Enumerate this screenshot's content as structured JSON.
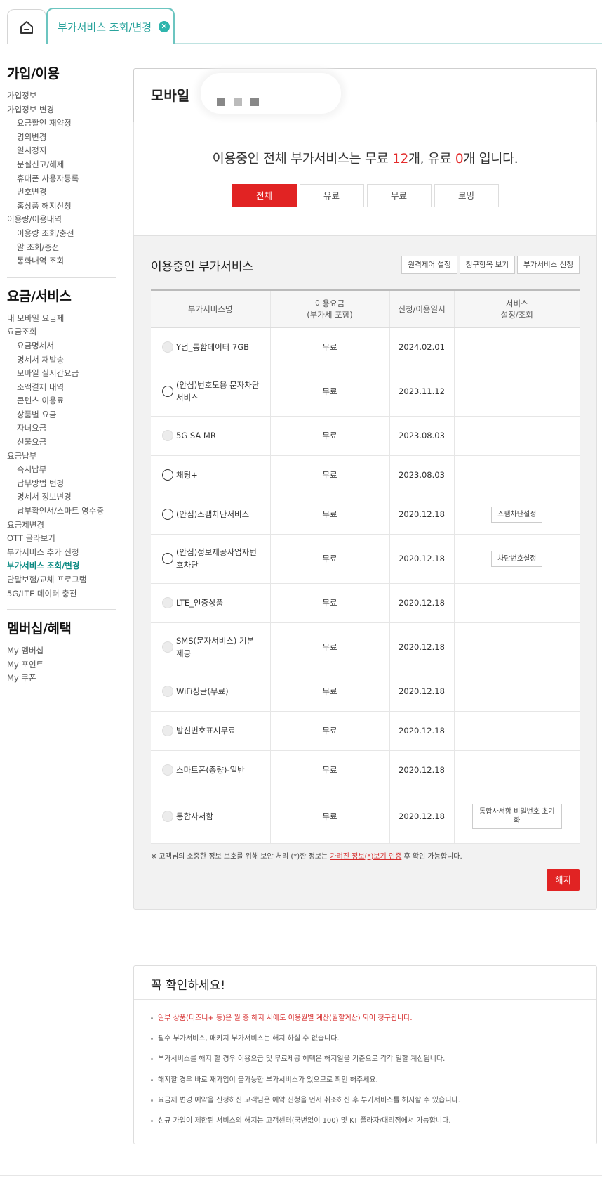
{
  "tabs": {
    "home_icon": "home-icon",
    "active_tab": "부가서비스 조회/변경",
    "close_glyph": "✕"
  },
  "sidebar": {
    "sections": [
      {
        "title": "가입/이용",
        "items": [
          {
            "label": "가입정보",
            "sub": false
          },
          {
            "label": "가입정보 변경",
            "sub": false
          },
          {
            "label": "요금할인 재약정",
            "sub": true
          },
          {
            "label": "명의변경",
            "sub": true
          },
          {
            "label": "일시정지",
            "sub": true
          },
          {
            "label": "분실신고/해제",
            "sub": true
          },
          {
            "label": "휴대폰 사용자등록",
            "sub": true
          },
          {
            "label": "번호변경",
            "sub": true
          },
          {
            "label": "홈상품 해지신청",
            "sub": true
          },
          {
            "label": "이용량/이용내역",
            "sub": false
          },
          {
            "label": "이용량 조회/충전",
            "sub": true
          },
          {
            "label": "알 조회/충전",
            "sub": true
          },
          {
            "label": "통화내역 조회",
            "sub": true
          }
        ]
      },
      {
        "title": "요금/서비스",
        "items": [
          {
            "label": "내 모바일 요금제",
            "sub": false
          },
          {
            "label": "요금조회",
            "sub": false
          },
          {
            "label": "요금명세서",
            "sub": true
          },
          {
            "label": "명세서 재발송",
            "sub": true
          },
          {
            "label": "모바일 실시간요금",
            "sub": true
          },
          {
            "label": "소액결제 내역",
            "sub": true
          },
          {
            "label": "콘텐츠 이용료",
            "sub": true
          },
          {
            "label": "상품별 요금",
            "sub": true
          },
          {
            "label": "자녀요금",
            "sub": true
          },
          {
            "label": "선불요금",
            "sub": true
          },
          {
            "label": "요금납부",
            "sub": false
          },
          {
            "label": "즉시납부",
            "sub": true
          },
          {
            "label": "납부방법 변경",
            "sub": true
          },
          {
            "label": "명세서 정보변경",
            "sub": true
          },
          {
            "label": "납부확인서/스마트 영수증",
            "sub": true
          },
          {
            "label": "요금제변경",
            "sub": false
          },
          {
            "label": "OTT 골라보기",
            "sub": false
          },
          {
            "label": "부가서비스 추가 신청",
            "sub": false
          },
          {
            "label": "부가서비스 조회/변경",
            "sub": false,
            "active": true
          },
          {
            "label": "단말보험/교체 프로그램",
            "sub": false
          },
          {
            "label": "5G/LTE 데이터 충전",
            "sub": false
          }
        ]
      },
      {
        "title": "멤버십/혜택",
        "items": [
          {
            "label": "My 멤버십",
            "sub": false
          },
          {
            "label": "My 포인트",
            "sub": false
          },
          {
            "label": "My 쿠폰",
            "sub": false
          }
        ]
      }
    ]
  },
  "main": {
    "mobile_title": "모바일",
    "summary": {
      "prefix": "이용중인 전체 부가서비스는 무료 ",
      "free_count": "12",
      "mid": "개, 유료 ",
      "paid_count": "0",
      "suffix": "개 입니다."
    },
    "filters": [
      "전체",
      "유료",
      "무료",
      "로밍"
    ],
    "active_filter": 0,
    "list_title": "이용중인 부가서비스",
    "list_buttons": [
      "원격제어 설정",
      "청구항목 보기",
      "부가서비스 신청"
    ],
    "table": {
      "headers": [
        "부가서비스명",
        "이용요금\n(부가세 포함)",
        "신청/이용일시",
        "서비스\n설정/조회"
      ],
      "rows": [
        {
          "name": "Y덤_통합데이터 7GB",
          "fee": "무료",
          "date": "2024.02.01",
          "action": "",
          "enabled": false,
          "h": 56
        },
        {
          "name": "(안심)번호도용 문자차단서비스",
          "fee": "무료",
          "date": "2023.11.12",
          "action": "",
          "enabled": true,
          "h": 70
        },
        {
          "name": "5G SA MR",
          "fee": "무료",
          "date": "2023.08.03",
          "action": "",
          "enabled": false,
          "h": 56
        },
        {
          "name": "채팅+",
          "fee": "무료",
          "date": "2023.08.03",
          "action": "",
          "enabled": true,
          "h": 56
        },
        {
          "name": "(안심)스팸차단서비스",
          "fee": "무료",
          "date": "2020.12.18",
          "action": "스팸차단설정",
          "enabled": true,
          "h": 56
        },
        {
          "name": "(안심)정보제공사업자번호차단",
          "fee": "무료",
          "date": "2020.12.18",
          "action": "차단번호설정",
          "enabled": true,
          "h": 70
        },
        {
          "name": "LTE_인증상품",
          "fee": "무료",
          "date": "2020.12.18",
          "action": "",
          "enabled": false,
          "h": 56
        },
        {
          "name": "SMS(문자서비스) 기본제공",
          "fee": "무료",
          "date": "2020.12.18",
          "action": "",
          "enabled": false,
          "h": 70
        },
        {
          "name": "WiFi싱글(무료)",
          "fee": "무료",
          "date": "2020.12.18",
          "action": "",
          "enabled": false,
          "h": 56
        },
        {
          "name": "발신번호표시무료",
          "fee": "무료",
          "date": "2020.12.18",
          "action": "",
          "enabled": false,
          "h": 56
        },
        {
          "name": "스마트폰(종량)-일반",
          "fee": "무료",
          "date": "2020.12.18",
          "action": "",
          "enabled": false,
          "h": 56
        },
        {
          "name": "통합사서함",
          "fee": "무료",
          "date": "2020.12.18",
          "action": "통합사서함 비밀번호 초기화",
          "enabled": false,
          "h": 76
        }
      ]
    },
    "notice": {
      "prefix": "※ 고객님의 소중한 정보 보호를 위해 보안 처리 (*)한 정보는 ",
      "link": "가려진 정보(*)보기 인증",
      "suffix": " 후 확인 가능합니다."
    },
    "cancel_label": "해지"
  },
  "check": {
    "title": "꼭 확인하세요!",
    "items": [
      {
        "text": "일부 상품(디즈니+ 등)은 월 중 해지 시에도 이용월별 계산(월할계산) 되어 청구됩니다.",
        "red": true
      },
      {
        "text": "필수 부가서비스, 패키지 부가서비스는 해지 하실 수 없습니다.",
        "red": false
      },
      {
        "text": "부가서비스를 해지 할 경우 이용요금 및 무료제공 혜택은 해지일을 기준으로 각각 일할 계산됩니다.",
        "red": false
      },
      {
        "text": "해지할 경우 바로 재가입이 불가능한 부가서비스가 있으므로 확인 해주세요.",
        "red": false
      },
      {
        "text": "요금제 변경 예약을 신청하신 고객님은 예약 신청을 먼저 취소하신 후 부가서비스를 해지할 수 있습니다.",
        "red": false
      },
      {
        "text": "신규 가입이 제한된 서비스의 해지는 고객센터(국번없이 100) 및 KT 플라자/대리점에서 가능합니다.",
        "red": false
      }
    ]
  },
  "colors": {
    "accent": "#e12323",
    "teal": "#29a39c"
  }
}
